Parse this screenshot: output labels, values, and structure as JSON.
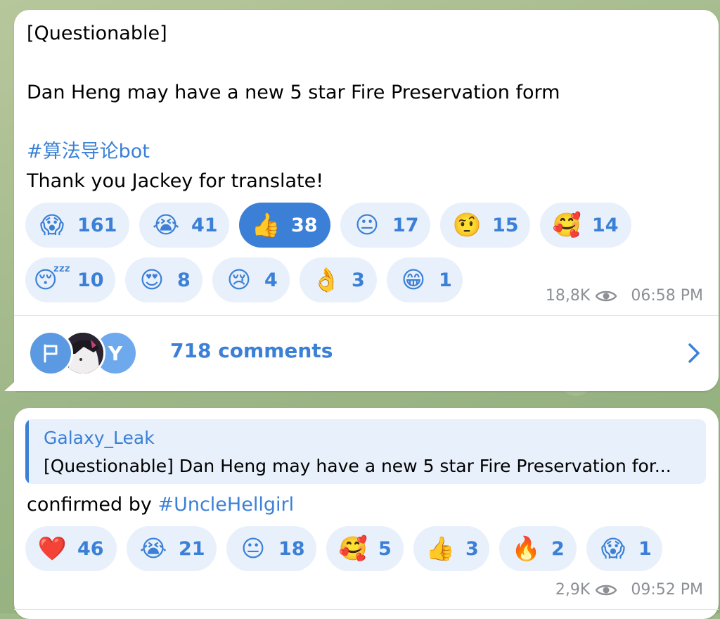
{
  "message1": {
    "line1": "[Questionable]",
    "line2": "Dan Heng may have a new 5 star Fire Preservation form",
    "hashtag": "#算法导论bot",
    "line3": "Thank you Jackey for translate!",
    "reactions": [
      {
        "emoji": "😱",
        "icon": "scream-emoji-icon",
        "count": "161",
        "active": false
      },
      {
        "emoji": "😭",
        "icon": "crying-emoji-icon",
        "count": "41",
        "active": false
      },
      {
        "emoji": "👍",
        "icon": "thumbs-up-emoji-icon",
        "count": "38",
        "active": true
      },
      {
        "emoji": "😐",
        "icon": "neutral-face-emoji-icon",
        "count": "17",
        "active": false
      },
      {
        "emoji": "🤨",
        "icon": "raised-eyebrow-emoji-icon",
        "count": "15",
        "active": false
      },
      {
        "emoji": "🥰",
        "icon": "smiling-hearts-emoji-icon",
        "count": "14",
        "active": false
      },
      {
        "emoji": "😴",
        "icon": "sleeping-emoji-icon",
        "count": "10",
        "active": false
      },
      {
        "emoji": "😍",
        "icon": "heart-eyes-emoji-icon",
        "count": "8",
        "active": false
      },
      {
        "emoji": "😢",
        "icon": "sad-tear-emoji-icon",
        "count": "4",
        "active": false
      },
      {
        "emoji": "👌",
        "icon": "ok-hand-emoji-icon",
        "count": "3",
        "active": false
      },
      {
        "emoji": "😁",
        "icon": "grin-emoji-icon",
        "count": "1",
        "active": false
      }
    ],
    "views": "18,8K",
    "time": "06:58 PM",
    "comments": {
      "label": "718 comments",
      "avatar3_letter": "Y"
    }
  },
  "message2": {
    "reply_name": "Galaxy_Leak",
    "reply_snippet": "[Questionable] Dan Heng may have a new 5 star Fire Preservation for...",
    "text_prefix": "confirmed by ",
    "text_link": "#UncleHellgirl",
    "reactions": [
      {
        "emoji": "❤️",
        "icon": "red-heart-emoji-icon",
        "count": "46",
        "active": false
      },
      {
        "emoji": "😭",
        "icon": "crying-emoji-icon",
        "count": "21",
        "active": false
      },
      {
        "emoji": "😐",
        "icon": "neutral-face-emoji-icon",
        "count": "18",
        "active": false
      },
      {
        "emoji": "🥰",
        "icon": "smiling-hearts-emoji-icon",
        "count": "5",
        "active": false
      },
      {
        "emoji": "👍",
        "icon": "thumbs-up-emoji-icon",
        "count": "3",
        "active": false
      },
      {
        "emoji": "🔥",
        "icon": "fire-emoji-icon",
        "count": "2",
        "active": false
      },
      {
        "emoji": "😱",
        "icon": "scream-emoji-icon",
        "count": "1",
        "active": false
      }
    ],
    "views": "2,9K",
    "time": "09:52 PM"
  },
  "colors": {
    "accent": "#3b80d6",
    "pill_bg": "#e8f0fb",
    "active_pill": "#3b7fd7",
    "meta_gray": "#8c8f94"
  }
}
